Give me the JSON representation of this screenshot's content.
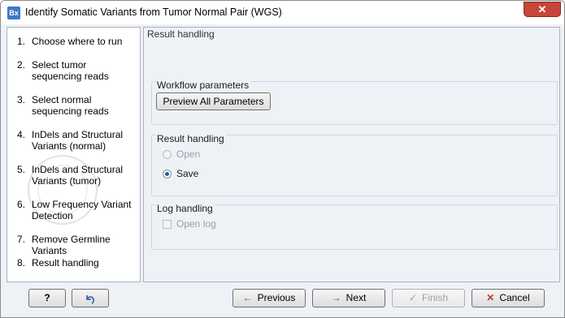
{
  "window": {
    "app_icon_text": "Bx",
    "title": "Identify Somatic Variants from Tumor Normal Pair (WGS)",
    "close_symbol": "✕"
  },
  "steps": [
    {
      "num": "1.",
      "label": "Choose where to run"
    },
    {
      "num": "2.",
      "label": "Select tumor sequencing reads"
    },
    {
      "num": "3.",
      "label": "Select normal sequencing reads"
    },
    {
      "num": "4.",
      "label": "InDels and Structural Variants (normal)"
    },
    {
      "num": "5.",
      "label": "InDels and Structural Variants (tumor)"
    },
    {
      "num": "6.",
      "label": "Low Frequency Variant Detection"
    },
    {
      "num": "7.",
      "label": "Remove Germline Variants"
    },
    {
      "num": "8.",
      "label": "Result handling"
    }
  ],
  "panel": {
    "title": "Result handling",
    "workflow_group": {
      "title": "Workflow parameters",
      "preview_button": "Preview All Parameters"
    },
    "result_group": {
      "title": "Result handling",
      "open_label": "Open",
      "save_label": "Save",
      "selected": "Save"
    },
    "log_group": {
      "title": "Log handling",
      "open_log_label": "Open log",
      "open_log_checked": false
    }
  },
  "buttons": {
    "help": "?",
    "reset_icon": "undo-arrow-icon",
    "previous": "Previous",
    "next": "Next",
    "finish": "Finish",
    "cancel": "Cancel"
  },
  "colors": {
    "accent": "#2a5aa0",
    "close_red": "#c7463a",
    "cancel_x": "#c0392b"
  }
}
